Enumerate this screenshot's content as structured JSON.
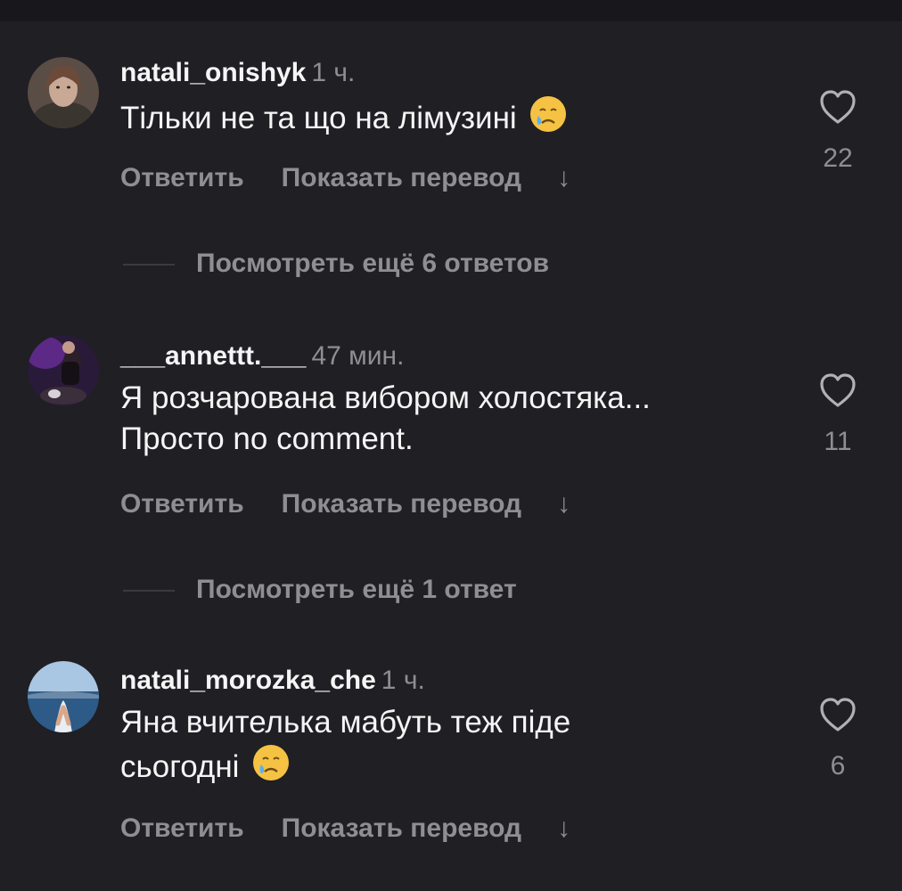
{
  "comments": [
    {
      "username": "natali_onishyk",
      "time": "1 ч.",
      "text": "Тільки не та що на лімузині",
      "emoji": "crying-face",
      "reply_label": "Ответить",
      "translate_label": "Показать перевод",
      "arrow": "↓",
      "likes": "22"
    },
    {
      "username": "___annettt.___",
      "time": "47 мин.",
      "text_line1": "Я розчарована вибором холостяка...",
      "text_line2": "Просто no comment.",
      "reply_label": "Ответить",
      "translate_label": "Показать перевод",
      "arrow": "↓",
      "likes": "11"
    },
    {
      "username": "natali_morozka_che",
      "time": "1 ч.",
      "text_line1": "Яна вчителька мабуть теж піде",
      "text_line2": "сьогодні",
      "emoji": "crying-face",
      "reply_label": "Ответить",
      "translate_label": "Показать перевод",
      "arrow": "↓",
      "likes": "6"
    }
  ],
  "view_replies": [
    "Посмотреть ещё 6 ответов",
    "Посмотреть ещё 1 ответ"
  ],
  "colors": {
    "background": "#1f1f24",
    "secondary_text": "#8e8e93",
    "primary_text": "#f5f5f5"
  }
}
